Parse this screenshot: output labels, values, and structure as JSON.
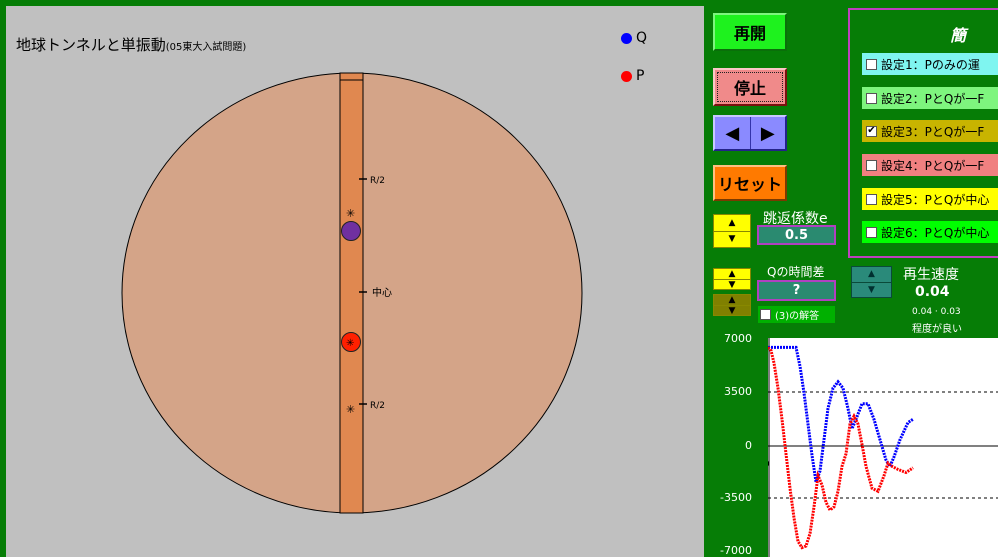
{
  "simulation": {
    "title": "地球トンネルと単振動",
    "subtitle": "(05東大入試問題)",
    "legend": [
      {
        "label": "Q",
        "color": "#0000ff"
      },
      {
        "label": "P",
        "color": "#ff0000"
      }
    ],
    "markers": {
      "upper_half": "R/2",
      "center": "中心",
      "lower_half": "R/2",
      "star": "✳"
    },
    "colors": {
      "earth": "#d4a488",
      "tunnel": "#e08850",
      "ball_upper": "#7030a0",
      "ball_lower": "#ff2000"
    }
  },
  "controls": {
    "resume_label": "再開",
    "stop_label": "停止",
    "prev_symbol": "◀",
    "next_symbol": "▶",
    "reset_label": "リセット",
    "restitution_label": "跳返係数e",
    "restitution_value": "0.5",
    "q_delay_label": "Qの時間差",
    "q_delay_value": "?",
    "answer_label": "(3)の解答",
    "answer_checked": false,
    "speed_label": "再生速度",
    "speed_value": "0.04",
    "speed_hint_line1": "0.04 · 0.03",
    "speed_hint_line2": "程度が良い",
    "up_symbol": "▲",
    "down_symbol": "▼"
  },
  "settings": {
    "title": "簡 易",
    "options": [
      {
        "label": "設定1：Pのみの運",
        "checked": false,
        "color": "#7ff5f0"
      },
      {
        "label": "設定2：PとQが一F",
        "checked": false,
        "color": "#7ef57e"
      },
      {
        "label": "設定3：PとQが一F",
        "checked": true,
        "color": "#c8b400"
      },
      {
        "label": "設定4：PとQが一F",
        "checked": false,
        "color": "#f08080"
      },
      {
        "label": "設定5：PとQが中心",
        "checked": false,
        "color": "#ffff00"
      },
      {
        "label": "設定6：PとQが中心",
        "checked": false,
        "color": "#00ff00"
      }
    ]
  },
  "chart_data": {
    "type": "line",
    "y_ticks": [
      "7000",
      "3500",
      "0",
      "-3500",
      "-7000"
    ],
    "x_tick_label": "0",
    "ylim": [
      -7000,
      7000
    ],
    "series": [
      {
        "name": "Q",
        "color": "#0000ff",
        "points": [
          [
            0,
            6400
          ],
          [
            10,
            6400
          ],
          [
            22,
            6400
          ],
          [
            28,
            6400
          ],
          [
            32,
            5200
          ],
          [
            36,
            3500
          ],
          [
            40,
            1500
          ],
          [
            44,
            -500
          ],
          [
            48,
            -2200
          ],
          [
            52,
            -1500
          ],
          [
            56,
            500
          ],
          [
            60,
            2500
          ],
          [
            65,
            3800
          ],
          [
            70,
            4200
          ],
          [
            75,
            3800
          ],
          [
            80,
            2500
          ],
          [
            84,
            1200
          ],
          [
            88,
            1800
          ],
          [
            94,
            2800
          ],
          [
            100,
            2800
          ],
          [
            106,
            1800
          ],
          [
            112,
            500
          ],
          [
            118,
            -800
          ],
          [
            122,
            -1200
          ],
          [
            126,
            -600
          ],
          [
            132,
            500
          ],
          [
            140,
            1600
          ],
          [
            145,
            1800
          ]
        ]
      },
      {
        "name": "P",
        "color": "#ff0000",
        "points": [
          [
            0,
            6400
          ],
          [
            3,
            6200
          ],
          [
            6,
            5400
          ],
          [
            10,
            3800
          ],
          [
            14,
            1800
          ],
          [
            18,
            -400
          ],
          [
            22,
            -2600
          ],
          [
            26,
            -4500
          ],
          [
            30,
            -6000
          ],
          [
            34,
            -6400
          ],
          [
            38,
            -6300
          ],
          [
            42,
            -5500
          ],
          [
            46,
            -3800
          ],
          [
            50,
            -1800
          ],
          [
            54,
            -2400
          ],
          [
            58,
            -3500
          ],
          [
            62,
            -4000
          ],
          [
            66,
            -3800
          ],
          [
            70,
            -2800
          ],
          [
            74,
            -1200
          ],
          [
            78,
            -400
          ],
          [
            82,
            1500
          ],
          [
            86,
            2000
          ],
          [
            90,
            1500
          ],
          [
            94,
            200
          ],
          [
            98,
            -1200
          ],
          [
            104,
            -2600
          ],
          [
            110,
            -2800
          ],
          [
            116,
            -1800
          ],
          [
            120,
            -1000
          ],
          [
            124,
            -1200
          ],
          [
            130,
            -1400
          ],
          [
            138,
            -1600
          ],
          [
            145,
            -1300
          ]
        ]
      }
    ]
  }
}
